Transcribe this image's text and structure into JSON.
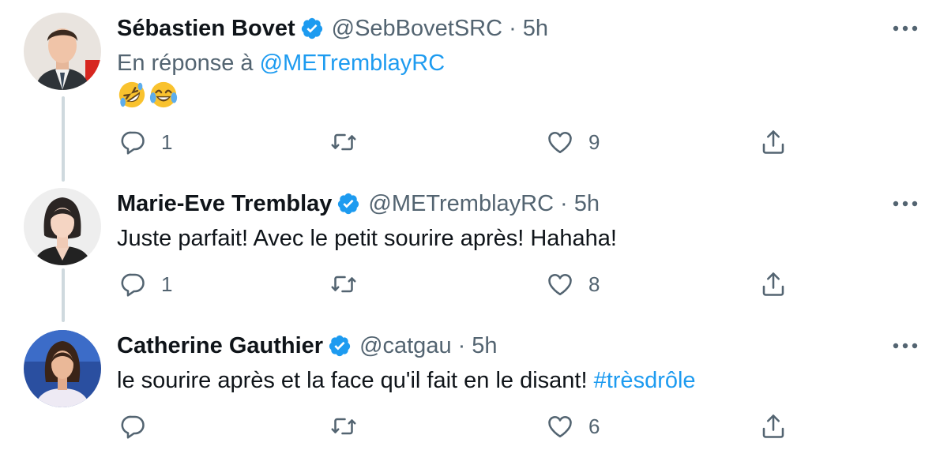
{
  "tweets": [
    {
      "name": "Sébastien Bovet",
      "handle": "@SebBovetSRC",
      "separator": "·",
      "time": "5h",
      "reply_prefix": "En réponse à",
      "reply_handle": "@METremblayRC",
      "emojis": [
        "rolling-on-floor-laughing",
        "face-with-tears-of-joy"
      ],
      "replies": "1",
      "retweets": "",
      "likes": "9"
    },
    {
      "name": "Marie-Eve Tremblay",
      "handle": "@METremblayRC",
      "separator": "·",
      "time": "5h",
      "text": "Juste parfait! Avec le petit sourire après! Hahaha!",
      "replies": "1",
      "retweets": "",
      "likes": "8"
    },
    {
      "name": "Catherine Gauthier",
      "handle": "@catgau",
      "separator": "·",
      "time": "5h",
      "text_plain": "le sourire après et la face qu'il fait en le disant! ",
      "hashtag": "#trèsdrôle",
      "replies": "",
      "retweets": "",
      "likes": "6"
    }
  ],
  "colors": {
    "accent": "#1d9bf0",
    "text": "#0f1419",
    "secondary": "#536471",
    "thread_line": "#cfd9de"
  },
  "icons": [
    "reply-icon",
    "retweet-icon",
    "like-icon",
    "share-icon",
    "verified-badge-icon",
    "more-icon"
  ]
}
